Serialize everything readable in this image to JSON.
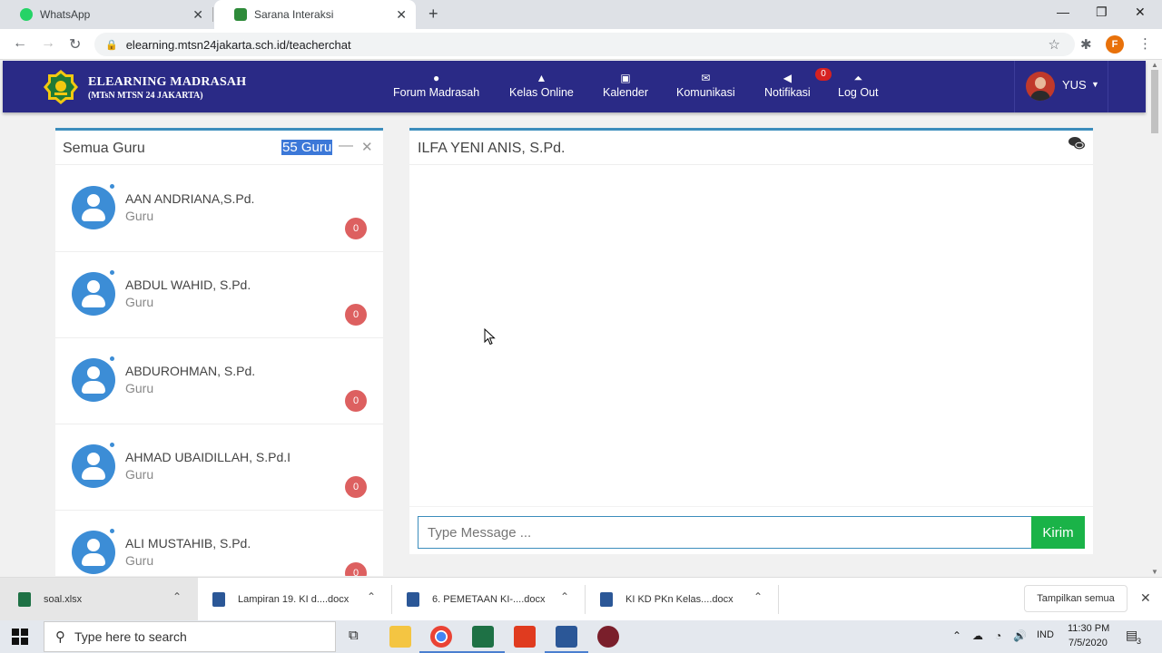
{
  "browser": {
    "tabs": [
      {
        "title": "WhatsApp"
      },
      {
        "title": "Sarana Interaksi"
      }
    ],
    "url": "elearning.mtsn24jakarta.sch.id/teacherchat",
    "profile_initial": "F"
  },
  "site": {
    "brand_title": "ELEARNING MADRASAH",
    "brand_subtitle": "(MTsN MTSN 24 JAKARTA)",
    "nav": [
      {
        "label": "Forum Madrasah",
        "icon": "chat-bubbles-icon"
      },
      {
        "label": "Kelas Online",
        "icon": "graduation-cap-icon"
      },
      {
        "label": "Kalender",
        "icon": "calendar-icon"
      },
      {
        "label": "Komunikasi",
        "icon": "envelope-icon"
      },
      {
        "label": "Notifikasi",
        "icon": "megaphone-icon"
      },
      {
        "label": "Log Out",
        "icon": "logout-icon"
      }
    ],
    "notification_count": "0",
    "user_name": "YUS"
  },
  "contacts_panel": {
    "title": "Semua Guru",
    "count_label": "55 Guru",
    "contacts": [
      {
        "name": "AAN ANDRIANA,S.Pd.",
        "role": "Guru",
        "unread": "0"
      },
      {
        "name": "ABDUL WAHID, S.Pd.",
        "role": "Guru",
        "unread": "0"
      },
      {
        "name": "ABDUROHMAN, S.Pd.",
        "role": "Guru",
        "unread": "0"
      },
      {
        "name": "AHMAD UBAIDILLAH, S.Pd.I",
        "role": "Guru",
        "unread": "0"
      },
      {
        "name": "ALI MUSTAHIB, S.Pd.",
        "role": "Guru",
        "unread": "0"
      }
    ]
  },
  "chat_panel": {
    "recipient": "ILFA YENI ANIS, S.Pd.",
    "input_placeholder": "Type Message ...",
    "send_label": "Kirim"
  },
  "downloads": {
    "items": [
      {
        "filename": "soal.xlsx",
        "type": "excel"
      },
      {
        "filename": "Lampiran 19. KI d....docx",
        "type": "word"
      },
      {
        "filename": "6. PEMETAAN KI-....docx",
        "type": "word"
      },
      {
        "filename": "KI KD PKn Kelas....docx",
        "type": "word"
      }
    ],
    "show_all_label": "Tampilkan semua"
  },
  "taskbar": {
    "search_placeholder": "Type here to search",
    "language": "IND",
    "time": "11:30 PM",
    "date": "7/5/2020",
    "notification_count": "3"
  },
  "colors": {
    "header_bg": "#2a2a86",
    "panel_accent": "#3c8dbc",
    "send_button": "#1ab348",
    "badge": "#dd6060",
    "avatar": "#3c8dd6"
  }
}
